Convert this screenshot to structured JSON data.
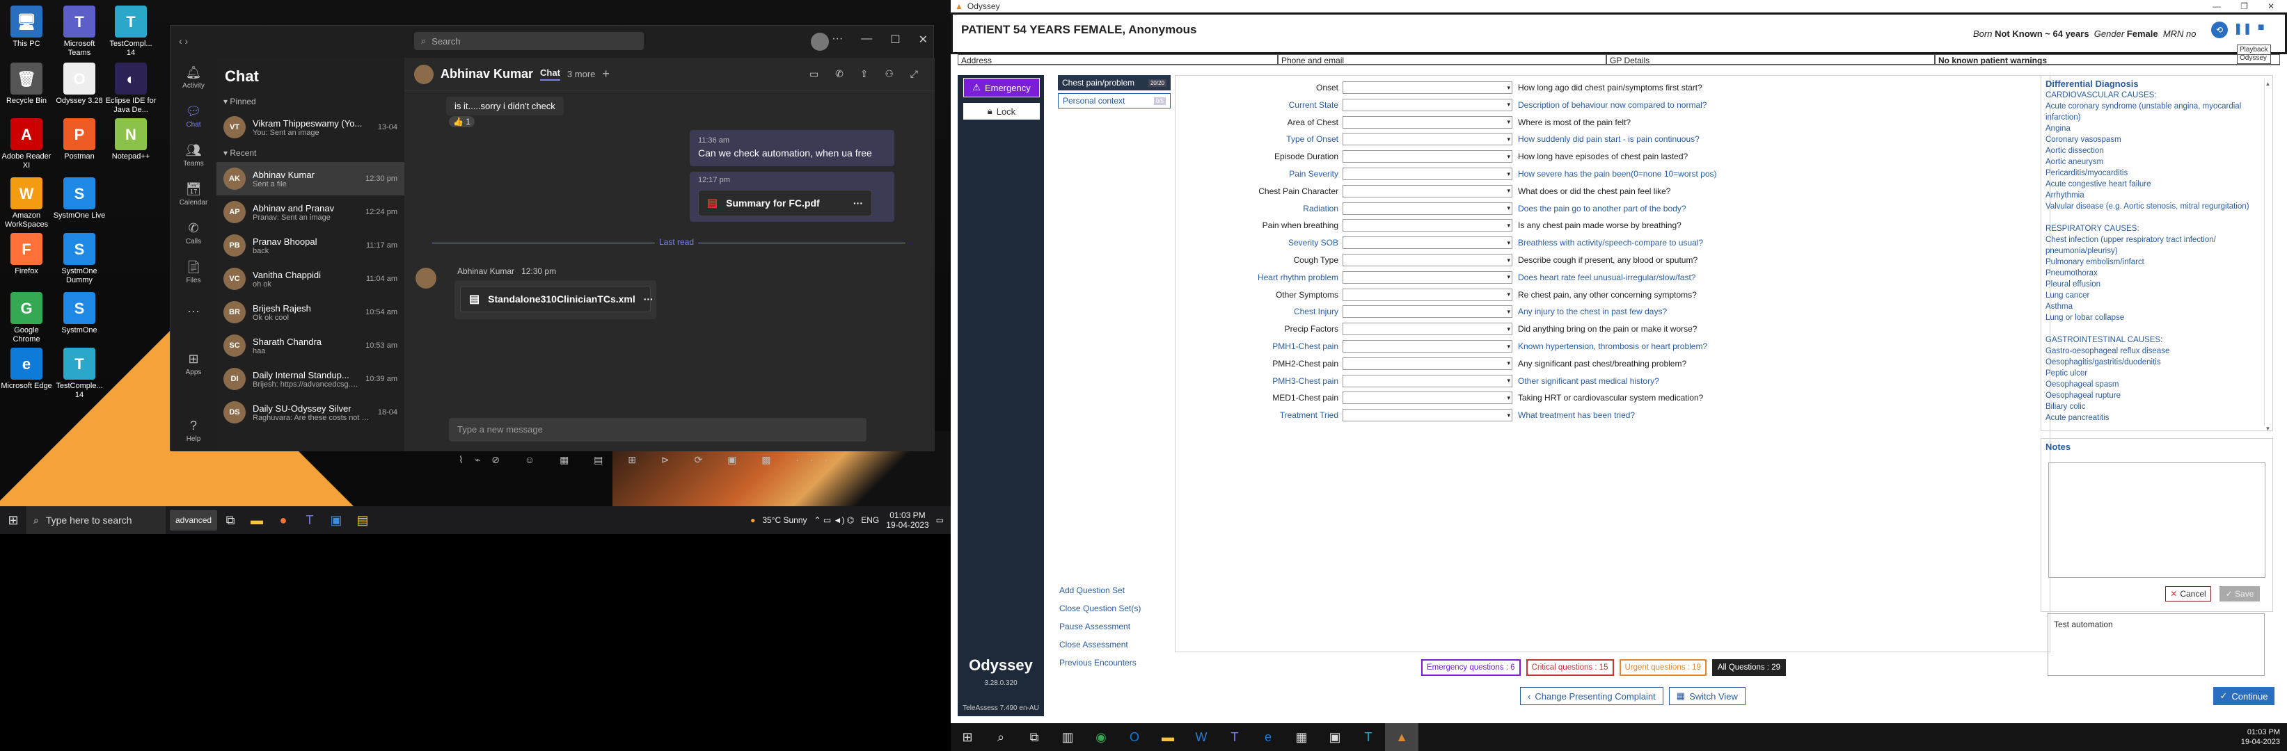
{
  "desktop": {
    "icons": [
      {
        "label": "This PC",
        "color": "#2a6fbf",
        "glyph": "🖥"
      },
      {
        "label": "Microsoft Teams",
        "color": "#5b5fc7",
        "glyph": "T"
      },
      {
        "label": "TestCompl... 14",
        "color": "#2aa7c9",
        "glyph": "T"
      },
      {
        "label": "Recycle Bin",
        "color": "#555",
        "glyph": "🗑"
      },
      {
        "label": "Odyssey 3.28",
        "color": "#eee",
        "glyph": "O"
      },
      {
        "label": "Eclipse IDE for Java De...",
        "color": "#2c2255",
        "glyph": "◐"
      },
      {
        "label": "Adobe Reader XI",
        "color": "#c00",
        "glyph": "A"
      },
      {
        "label": "Postman",
        "color": "#ef5b25",
        "glyph": "P"
      },
      {
        "label": "Notepad++",
        "color": "#8bc34a",
        "glyph": "N"
      },
      {
        "label": "Amazon WorkSpaces",
        "color": "#f39c12",
        "glyph": "W"
      },
      {
        "label": "SystmOne Live",
        "color": "#1e88e5",
        "glyph": "S"
      },
      {
        "label": "Firefox",
        "color": "#ff7139",
        "glyph": "F"
      },
      {
        "label": "SystmOne Dummy",
        "color": "#1e88e5",
        "glyph": "S"
      },
      {
        "label": "Google Chrome",
        "color": "#34a853",
        "glyph": "G"
      },
      {
        "label": "SystmOne",
        "color": "#1e88e5",
        "glyph": "S"
      },
      {
        "label": "Microsoft Edge",
        "color": "#0f7bd8",
        "glyph": "e"
      },
      {
        "label": "TestComple... 14",
        "color": "#2aa7c9",
        "glyph": "T"
      }
    ],
    "taskbar": {
      "search_placeholder": "Type here to search",
      "advanced_label": "advanced",
      "weather": "35°C  Sunny",
      "lang": "ENG",
      "time": "01:03 PM",
      "date": "19-04-2023"
    }
  },
  "teams": {
    "search_placeholder": "Search",
    "rail": [
      "Activity",
      "Chat",
      "Teams",
      "Calendar",
      "Calls",
      "Files",
      "...",
      "Apps",
      "Help"
    ],
    "chat_title": "Chat",
    "pinned_label": "Pinned",
    "recent_label": "Recent",
    "pinned": [
      {
        "name": "Vikram Thippeswamy (Yo...",
        "preview": "You: Sent an image",
        "time": "13-04",
        "initials": "VT"
      }
    ],
    "recent": [
      {
        "name": "Abhinav Kumar",
        "preview": "Sent a file",
        "time": "12:30 pm",
        "initials": "AK",
        "active": true
      },
      {
        "name": "Abhinav and Pranav",
        "preview": "Pranav: Sent an image",
        "time": "12:24 pm",
        "initials": "AP"
      },
      {
        "name": "Pranav Bhoopal",
        "preview": "back",
        "time": "11:17 am",
        "initials": "PB"
      },
      {
        "name": "Vanitha Chappidi",
        "preview": "oh ok",
        "time": "11:04 am",
        "initials": "VC"
      },
      {
        "name": "Brijesh Rajesh",
        "preview": "Ok ok cool",
        "time": "10:54 am",
        "initials": "BR"
      },
      {
        "name": "Sharath Chandra",
        "preview": "haa",
        "time": "10:53 am",
        "initials": "SC"
      },
      {
        "name": "Daily Internal Standup...",
        "preview": "Brijesh: https://advancedcsg.atl...",
        "time": "10:39 am",
        "initials": "DI"
      },
      {
        "name": "Daily SU-Odyssey Silver",
        "preview": "Raghuvara: Are these costs not c...",
        "time": "18-04",
        "initials": "DS"
      }
    ],
    "conv": {
      "name": "Abhinav Kumar",
      "tab": "Chat",
      "more": "3 more",
      "msg1": "is it.....sorry i didn't check",
      "reaction": "👍 1",
      "msg2_time": "11:36 am",
      "msg2": "Can we check automation, when ua free",
      "msg3_time": "12:17 pm",
      "file1": "Summary for FC.pdf",
      "last_read": "Last read",
      "sender": "Abhinav Kumar",
      "sender_time": "12:30 pm",
      "file2": "Standalone310ClinicianTCs.xml",
      "compose_placeholder": "Type a new message"
    }
  },
  "odyssey": {
    "window_title": "Odyssey",
    "patient": "PATIENT 54 YEARS FEMALE, Anonymous",
    "born_label": "Born",
    "born_value": "Not Known ~ 64 years",
    "gender_label": "Gender",
    "gender_value": "Female",
    "mrn_label": "MRN no",
    "playback": "Playback",
    "playback2": "Odyssey",
    "address": "Address",
    "phone": "Phone and email",
    "gp": "GP Details",
    "warnings": "No known patient warnings",
    "emergency": "Emergency",
    "lock": "Lock",
    "sections": [
      {
        "label": "Chest pain/problem",
        "count": "20/20"
      },
      {
        "label": "Personal context",
        "count": "0/5"
      }
    ],
    "actions": [
      "Add Question Set",
      "Close Question Set(s)",
      "Pause Assessment",
      "Close Assessment",
      "Previous Encounters"
    ],
    "logo": "Odyssey",
    "version": "3.28.0.320",
    "teleassess": "TeleAssess 7.490 en-AU",
    "questions": [
      {
        "label": "Onset",
        "text": "How long ago did chest pain/symptoms first start?",
        "blue": false
      },
      {
        "label": "Current State",
        "text": "Description of behaviour now compared to normal?",
        "blue": true
      },
      {
        "label": "Area of Chest",
        "text": "Where is most of the pain felt?",
        "blue": false
      },
      {
        "label": "Type of Onset",
        "text": "How suddenly did pain start - is pain continuous?",
        "blue": true
      },
      {
        "label": "Episode Duration",
        "text": "How long have episodes of chest pain lasted?",
        "blue": false
      },
      {
        "label": "Pain Severity",
        "text": "How severe has the pain been(0=none 10=worst pos)",
        "blue": true
      },
      {
        "label": "Chest Pain Character",
        "text": "What does or did the chest pain feel like?",
        "blue": false
      },
      {
        "label": "Radiation",
        "text": "Does the pain go to another part of the body?",
        "blue": true
      },
      {
        "label": "Pain when breathing",
        "text": "Is any chest pain made worse by breathing?",
        "blue": false
      },
      {
        "label": "Severity SOB",
        "text": "Breathless with activity/speech-compare to usual?",
        "blue": true
      },
      {
        "label": "Cough Type",
        "text": "Describe cough if present, any blood or sputum?",
        "blue": false
      },
      {
        "label": "Heart rhythm problem",
        "text": "Does heart rate feel unusual-irregular/slow/fast?",
        "blue": true
      },
      {
        "label": "Other Symptoms",
        "text": "Re chest pain, any other concerning symptoms?",
        "blue": false
      },
      {
        "label": "Chest Injury",
        "text": "Any injury to the chest in past few days?",
        "blue": true
      },
      {
        "label": "Precip Factors",
        "text": "Did anything bring on the pain or make it worse?",
        "blue": false
      },
      {
        "label": "PMH1-Chest pain",
        "text": "Known hypertension, thrombosis or heart problem?",
        "blue": true
      },
      {
        "label": "PMH2-Chest pain",
        "text": "Any significant past chest/breathing problem?",
        "blue": false
      },
      {
        "label": "PMH3-Chest pain",
        "text": "Other significant past medical history?",
        "blue": true
      },
      {
        "label": "MED1-Chest pain",
        "text": "Taking HRT or cardiovascular system medication?",
        "blue": false
      },
      {
        "label": "Treatment Tried",
        "text": "What treatment has been tried?",
        "blue": true
      }
    ],
    "diff_title": "Differential Diagnosis",
    "diff_lines": [
      "CARDIOVASCULAR CAUSES:",
      "Acute coronary syndrome (unstable angina, myocardial",
      "infarction)",
      "Angina",
      "Coronary vasospasm",
      "Aortic dissection",
      "Aortic aneurysm",
      "Pericarditis/myocarditis",
      "Acute congestive heart failure",
      "Arrhythmia",
      "Valvular disease (e.g. Aortic stenosis, mitral regurgitation)",
      "",
      "RESPIRATORY CAUSES:",
      "Chest infection (upper respiratory tract infection/",
      "pneumonia/pleurisy)",
      "Pulmonary embolism/infarct",
      "Pneumothorax",
      "Pleural effusion",
      "Lung cancer",
      "Asthma",
      "Lung or lobar collapse",
      "",
      "GASTROINTESTINAL CAUSES:",
      "Gastro-oesophageal reflux disease",
      "Oesophagitis/gastritis/duodenitis",
      "Peptic ulcer",
      "Oesophageal spasm",
      "Oesophageal rupture",
      "Biliary colic",
      "Acute pancreatitis"
    ],
    "notes_title": "Notes",
    "cancel": "Cancel",
    "save": "Save",
    "test_automation": "Test automation",
    "counters": {
      "emergency": "Emergency questions : 6",
      "critical": "Critical questions : 15",
      "urgent": "Urgent questions : 19",
      "all": "All Questions : 29"
    },
    "change_complaint": "Change Presenting Complaint",
    "switch_view": "Switch View",
    "continue": "Continue",
    "clock_time": "01:03 PM",
    "clock_date": "19-04-2023"
  }
}
